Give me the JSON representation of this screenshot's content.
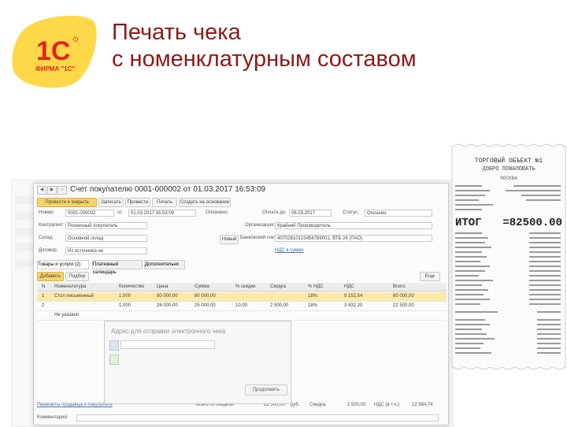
{
  "title": {
    "line1": "Печать чека",
    "line2": "с номенклатурным составом"
  },
  "logo": {
    "brand": "1С",
    "caption": "ФИРМА \"1С\"",
    "colors": {
      "yellow": "#ffd84a",
      "red": "#e2231a"
    }
  },
  "doc": {
    "header_title": "Счет покупателю 0001-000002 от 01.03.2017 16:53:09",
    "toolbar": {
      "post_close": "Провести и закрыть",
      "save": "Записать",
      "post": "Провести",
      "print": "Печать",
      "create_based": "Создать на основании"
    },
    "fields": {
      "number_label": "Номер:",
      "number_value": "0001-000002",
      "from_label": "от:",
      "from_value": "01.03.2017 16:53:09",
      "paid_label": "Оплачено:",
      "pay_date_label": "Оплата до:",
      "pay_date_value": "06.03.2017",
      "status_label": "Статус:",
      "status_value": "Оплачен",
      "customer_label": "Контрагент:",
      "customer_value": "Розничный покупатель",
      "org_label": "Организация:",
      "org_value": "Крайний Производитель",
      "warehouse_label": "Склад:",
      "warehouse_value": "Основной склад",
      "bank_label": "Банковский счет:",
      "bank_value": "40702810123456789001, ВТБ 24 (ПАО)",
      "new_button": "Новый",
      "vat_link": "НДС в сумме",
      "extra_value": "Из источника не",
      "agreement_label": "Договор:"
    },
    "tabs": [
      "Товары и услуги (2)",
      "Платежный календарь",
      "Дополнительно"
    ],
    "table_toolbar": {
      "add": "Добавить",
      "pick": "Подбор",
      "more": "Еще"
    },
    "table": {
      "headers": [
        "N",
        "Номенклатура",
        "Количество",
        "Цена",
        "Сумма",
        "% скидки",
        "Скидка",
        "% НДС",
        "НДС",
        "Всего"
      ],
      "rows": [
        [
          "1",
          "Стол письменный",
          "1,000",
          "80 000,00",
          "80 000,00",
          "",
          "",
          "18%",
          "9 152,54",
          "60 000,00"
        ],
        [
          "2",
          "",
          "1,000",
          "26 000,00",
          "25 000,00",
          "10,00",
          "2 500,00",
          "18%",
          "3 432,20",
          "22 500,00"
        ]
      ],
      "row2_extra": "Не указано"
    },
    "email_dialog": {
      "label": "Адрес для отправки электронного чека",
      "button": "Продолжить"
    },
    "footer": {
      "link": "Реквизиты продавца и покупателя",
      "comment_label": "Комментарий:",
      "total_discount_label": "Всего со скидкой:",
      "total_value": "82 500,00",
      "currency": "руб.",
      "discount_label": "Скидка:",
      "discount_value": "2 500,00",
      "vat_label": "НДС (в т.ч.):",
      "vat_value": "12 584,74"
    }
  },
  "receipt": {
    "title_line1": "ТОРГОВЫЙ ОБЪЕКТ №1",
    "title_line2": "ДОБРО ПОЖАЛОВАТЬ",
    "city": "МОСКВА",
    "total_label": "ИТОГ",
    "total_value": "=82500.00"
  }
}
